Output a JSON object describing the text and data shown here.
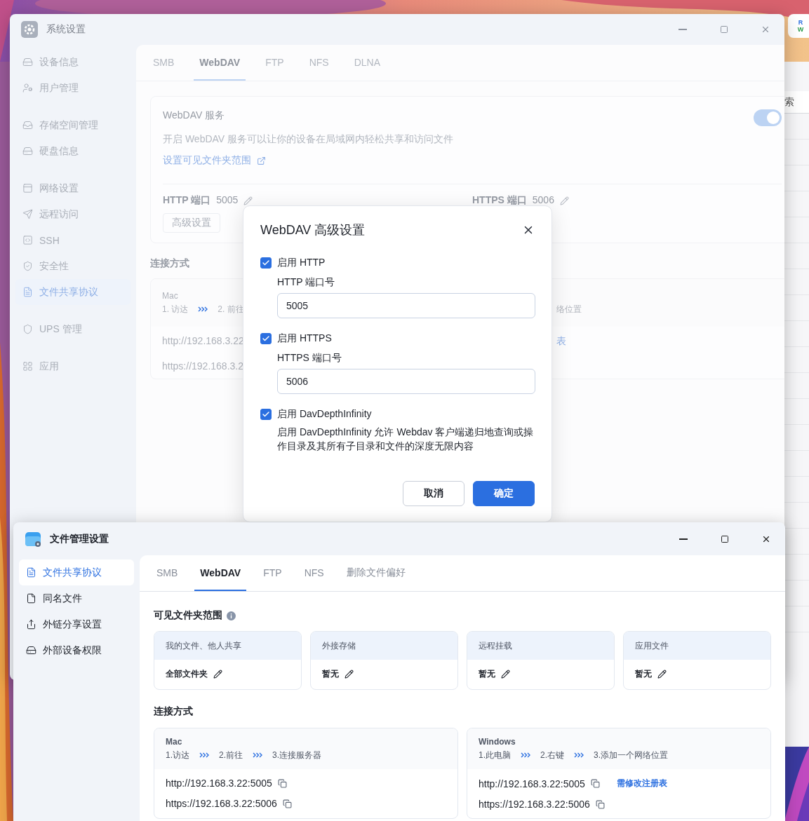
{
  "back_window": {
    "search_label": "索",
    "badge": [
      "R",
      "W"
    ]
  },
  "system_window": {
    "title": "系统设置",
    "sidebar": [
      [
        {
          "label": "设备信息",
          "selected": false
        },
        {
          "label": "用户管理",
          "selected": false
        }
      ],
      [
        {
          "label": "存储空间管理",
          "selected": false
        },
        {
          "label": "硬盘信息",
          "selected": false
        }
      ],
      [
        {
          "label": "网络设置",
          "selected": false
        },
        {
          "label": "远程访问",
          "selected": false
        },
        {
          "label": "SSH",
          "selected": false
        },
        {
          "label": "安全性",
          "selected": false
        },
        {
          "label": "文件共享协议",
          "selected": true
        }
      ],
      [
        {
          "label": "UPS 管理",
          "selected": false
        }
      ],
      [
        {
          "label": "应用",
          "selected": false
        }
      ]
    ],
    "tabs": [
      {
        "label": "SMB",
        "selected": false
      },
      {
        "label": "WebDAV",
        "selected": true
      },
      {
        "label": "FTP",
        "selected": false
      },
      {
        "label": "NFS",
        "selected": false
      },
      {
        "label": "DLNA",
        "selected": false
      }
    ],
    "service": {
      "title": "WebDAV 服务",
      "enabled": true,
      "description": "开启 WebDAV 服务可以让你的设备在局域网内轻松共享和访问文件",
      "link": "设置可见文件夹范围"
    },
    "ports": [
      {
        "label": "HTTP 端口",
        "value": "5005"
      },
      {
        "label": "HTTPS 端口",
        "value": "5006"
      }
    ],
    "advanced_button": "高级设置",
    "connection": {
      "title": "连接方式",
      "mac": {
        "name": "Mac",
        "steps": [
          "1. 访达",
          "2. 前往"
        ],
        "urls": [
          "http://192.168.3.22",
          "https://192.168.3.2"
        ]
      },
      "windows_fragment": {
        "step": "络位置",
        "link": "表"
      }
    }
  },
  "dialog": {
    "title": "WebDAV 高级设置",
    "options": [
      {
        "kind": "port",
        "label": "启用 HTTP",
        "checked": true,
        "field_label": "HTTP 端口号",
        "value": "5005"
      },
      {
        "kind": "port",
        "label": "启用 HTTPS",
        "checked": true,
        "field_label": "HTTPS 端口号",
        "value": "5006"
      },
      {
        "kind": "note",
        "label": "启用 DavDepthInfinity",
        "checked": true,
        "note": "启用 DavDepthInfinity 允许 Webdav 客户端递归地查询或操作目录及其所有子目录和文件的深度无限内容"
      }
    ],
    "buttons": [
      {
        "label": "取消",
        "primary": false
      },
      {
        "label": "确定",
        "primary": true
      }
    ]
  },
  "file_window": {
    "title": "文件管理设置",
    "sidebar": [
      {
        "label": "文件共享协议",
        "selected": true
      },
      {
        "label": "同名文件",
        "selected": false
      },
      {
        "label": "外链分享设置",
        "selected": false
      },
      {
        "label": "外部设备权限",
        "selected": false
      }
    ],
    "tabs": [
      {
        "label": "SMB",
        "selected": false
      },
      {
        "label": "WebDAV",
        "selected": true
      },
      {
        "label": "FTP",
        "selected": false
      },
      {
        "label": "NFS",
        "selected": false
      },
      {
        "label": "删除文件偏好",
        "selected": false
      }
    ],
    "scope": {
      "title": "可见文件夹范围",
      "cards": [
        {
          "title": "我的文件、他人共享",
          "value": "全部文件夹"
        },
        {
          "title": "外接存储",
          "value": "暂无"
        },
        {
          "title": "远程挂载",
          "value": "暂无"
        },
        {
          "title": "应用文件",
          "value": "暂无"
        }
      ]
    },
    "connection": {
      "title": "连接方式",
      "cards": [
        {
          "name": "Mac",
          "steps": [
            "1.访达",
            "2.前往",
            "3.连接服务器"
          ],
          "urls": [
            {
              "url": "http://192.168.3.22:5005"
            },
            {
              "url": "https://192.168.3.22:5006"
            }
          ]
        },
        {
          "name": "Windows",
          "steps": [
            "1.此电脑",
            "2.右键",
            "3.添加一个网络位置"
          ],
          "urls": [
            {
              "url": "http://192.168.3.22:5005",
              "link": "需修改注册表"
            },
            {
              "url": "https://192.168.3.22:5006"
            }
          ]
        }
      ]
    }
  }
}
